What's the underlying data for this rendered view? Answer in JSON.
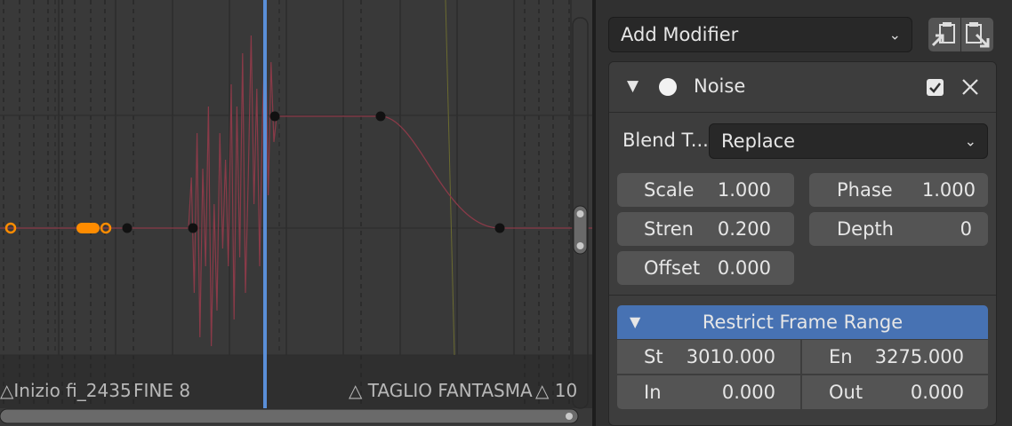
{
  "graph": {
    "markers": [
      "Inizio fi_2435",
      "FINE 8",
      "TAGLIO FANTASMA",
      "10"
    ],
    "marker_symbol": "△"
  },
  "panel": {
    "add_modifier_label": "Add Modifier",
    "modifier": {
      "name": "Noise",
      "enabled": true,
      "blend_type_label": "Blend T...",
      "blend_type_value": "Replace",
      "fields": [
        {
          "label": "Scale",
          "value": "1.000"
        },
        {
          "label": "Phase",
          "value": "1.000"
        },
        {
          "label": "Stren",
          "value": "0.200"
        },
        {
          "label": "Depth",
          "value": "0"
        },
        {
          "label": "Offset",
          "value": "0.000"
        }
      ],
      "restrict": {
        "title": "Restrict Frame Range",
        "fields": [
          {
            "label": "St",
            "value": "3010.000"
          },
          {
            "label": "En",
            "value": "3275.000"
          },
          {
            "label": "In",
            "value": "0.000"
          },
          {
            "label": "Out",
            "value": "0.000"
          }
        ]
      }
    }
  },
  "colors": {
    "curve": "#8a3a48",
    "playhead": "#5a8fd8",
    "selected_key": "#ff8c00",
    "restrict_header": "#4772b3"
  }
}
